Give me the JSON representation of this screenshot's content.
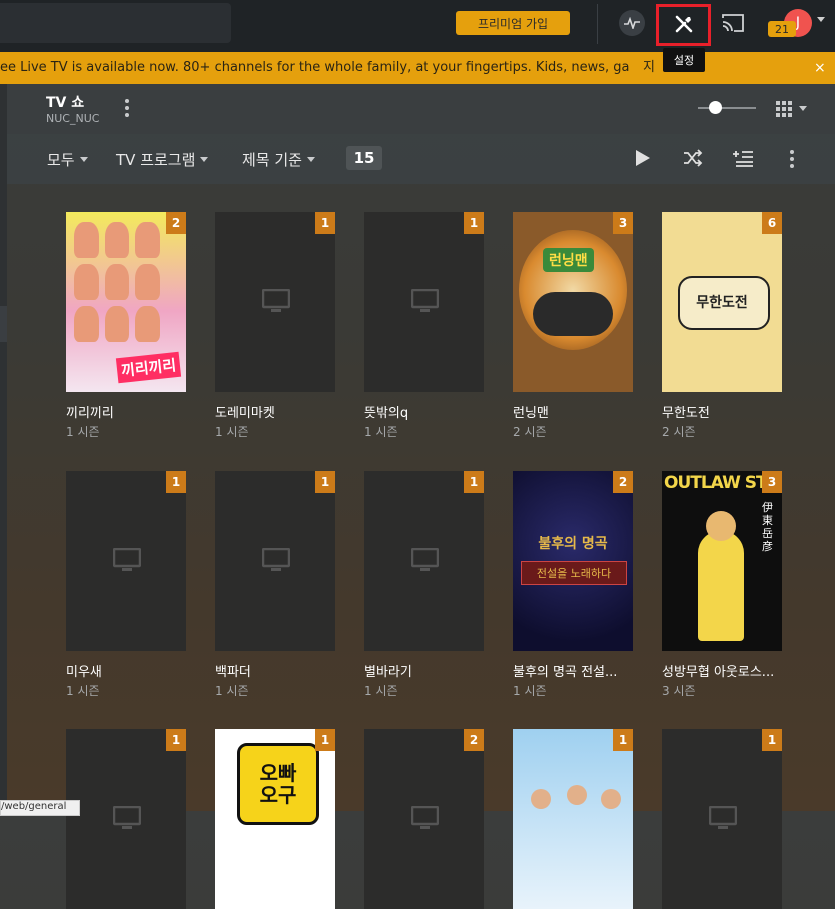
{
  "topbar": {
    "premium_label": "프리미엄 가입",
    "notification_count": "21",
    "avatar_initial": "J",
    "settings_tooltip": "설정"
  },
  "banner": {
    "text": "ee Live TV is available now. 80+ channels for the whole family, at your fingertips. Kids, news, ga...",
    "tail": "지",
    "close": "×"
  },
  "library": {
    "title": "TV 쇼",
    "server": "NUC_NUC"
  },
  "toolbar": {
    "filter_all": "모두",
    "filter_type": "TV 프로그램",
    "filter_sort": "제목 기준",
    "count": "15"
  },
  "shows": [
    {
      "title": "끼리끼리",
      "seasons": "1 시즌",
      "badge": "2",
      "poster": "art1"
    },
    {
      "title": "도레미마켓",
      "seasons": "1 시즌",
      "badge": "1",
      "poster": "placeholder"
    },
    {
      "title": "뜻밖의q",
      "seasons": "1 시즌",
      "badge": "1",
      "poster": "placeholder"
    },
    {
      "title": "런닝맨",
      "seasons": "2 시즌",
      "badge": "3",
      "poster": "art2"
    },
    {
      "title": "무한도전",
      "seasons": "2 시즌",
      "badge": "6",
      "poster": "art3"
    },
    {
      "title": "미우새",
      "seasons": "1 시즌",
      "badge": "1",
      "poster": "placeholder"
    },
    {
      "title": "백파더",
      "seasons": "1 시즌",
      "badge": "1",
      "poster": "placeholder"
    },
    {
      "title": "별바라기",
      "seasons": "1 시즌",
      "badge": "1",
      "poster": "placeholder"
    },
    {
      "title": "불후의 명곡 전설...",
      "seasons": "1 시즌",
      "badge": "2",
      "poster": "art4"
    },
    {
      "title": "성방무협 아웃로스...",
      "seasons": "3 시즌",
      "badge": "3",
      "poster": "art5"
    },
    {
      "title": "",
      "seasons": "",
      "badge": "1",
      "poster": "placeholder"
    },
    {
      "title": "",
      "seasons": "",
      "badge": "1",
      "poster": "art6"
    },
    {
      "title": "",
      "seasons": "",
      "badge": "2",
      "poster": "placeholder"
    },
    {
      "title": "",
      "seasons": "",
      "badge": "1",
      "poster": "art7"
    },
    {
      "title": "",
      "seasons": "",
      "badge": "1",
      "poster": "placeholder"
    }
  ],
  "poster_text": {
    "art1": "끼리끼리",
    "art2": "런닝맨",
    "art3": "무한도전",
    "art4a": "불후의 명곡",
    "art4b": "전설을 노래하다",
    "art5": "OUTLAW STAR",
    "art5b": "伊東岳彦",
    "art6": "오빠\n오구"
  },
  "status_url": "/web/general",
  "colors": {
    "accent": "#e5a00d",
    "badge": "#cc7b19",
    "highlight": "#e8202a"
  }
}
